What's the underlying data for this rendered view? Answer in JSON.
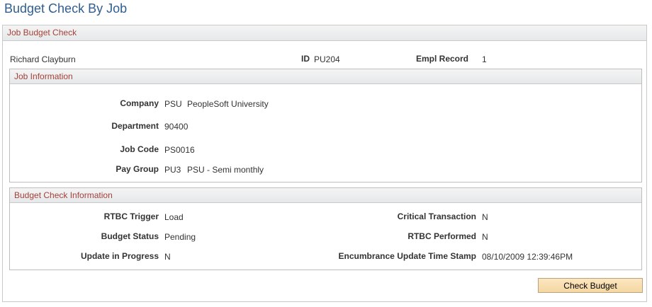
{
  "page": {
    "title": "Budget Check By Job"
  },
  "job_budget_check": {
    "title": "Job Budget Check",
    "name": "Richard Clayburn",
    "id_label": "ID",
    "id_value": "PU204",
    "empl_record_label": "Empl Record",
    "empl_record_value": "1"
  },
  "job_information": {
    "title": "Job Information",
    "company_label": "Company",
    "company_code": "PSU",
    "company_desc": "PeopleSoft University",
    "department_label": "Department",
    "department_value": "90400",
    "job_code_label": "Job Code",
    "job_code_value": "PS0016",
    "pay_group_label": "Pay Group",
    "pay_group_code": "PU3",
    "pay_group_desc": "PSU - Semi monthly"
  },
  "budget_check_information": {
    "title": "Budget Check Information",
    "rtbc_trigger_label": "RTBC Trigger",
    "rtbc_trigger_value": "Load",
    "budget_status_label": "Budget Status",
    "budget_status_value": "Pending",
    "update_in_progress_label": "Update in Progress",
    "update_in_progress_value": "N",
    "critical_transaction_label": "Critical Transaction",
    "critical_transaction_value": "N",
    "rtbc_performed_label": "RTBC Performed",
    "rtbc_performed_value": "N",
    "encumbrance_label": "Encumbrance Update Time Stamp",
    "encumbrance_value": "08/10/2009 12:39:46PM"
  },
  "actions": {
    "check_budget_label": "Check Budget"
  }
}
